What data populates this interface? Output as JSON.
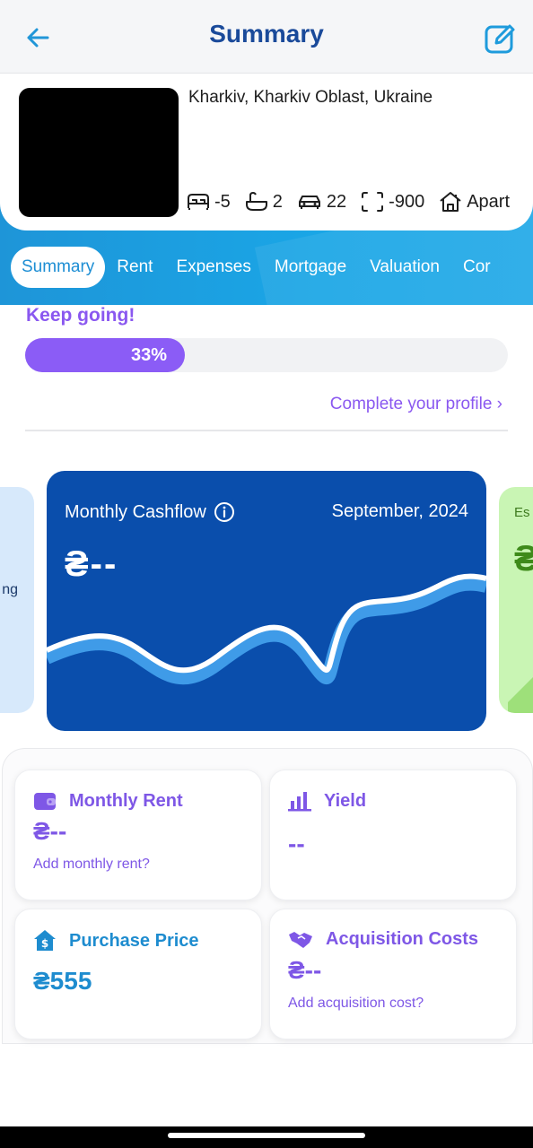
{
  "header": {
    "title": "Summary",
    "back_icon": "arrow-left-icon",
    "edit_icon": "edit-square-icon"
  },
  "property": {
    "location": "Kharkiv, Kharkiv Oblast, Ukraine",
    "attributes": [
      {
        "icon": "bed-icon",
        "value": "-5"
      },
      {
        "icon": "bathtub-icon",
        "value": "2"
      },
      {
        "icon": "car-icon",
        "value": "22"
      },
      {
        "icon": "area-icon",
        "value": "-900"
      },
      {
        "icon": "home-icon",
        "value": "Apart"
      }
    ]
  },
  "tabs": [
    "Summary",
    "Rent",
    "Expenses",
    "Mortgage",
    "Valuation",
    "Cor"
  ],
  "progress": {
    "label": "Keep going!",
    "percent_text": "33%",
    "percent": 33,
    "link": "Complete your profile ›"
  },
  "cards": {
    "left_partial_text": "ng",
    "cashflow": {
      "title": "Monthly Cashflow",
      "date": "September, 2024",
      "value": "₴--"
    },
    "right_partial_label": "Es",
    "right_partial_value": "₴"
  },
  "stats": {
    "monthly_rent": {
      "title": "Monthly Rent",
      "value": "₴--",
      "link": "Add monthly rent?"
    },
    "yield": {
      "title": "Yield",
      "value": "--"
    },
    "purchase_price": {
      "title": "Purchase Price",
      "value": "₴555"
    },
    "acquisition_costs": {
      "title": "Acquisition Costs",
      "value": "₴--",
      "link": "Add acquisition cost?"
    }
  },
  "colors": {
    "brand_blue": "#1a4a9a",
    "accent_purple": "#8b5cf6",
    "card_blue": "#0a4eac",
    "teal": "#1e8ccf"
  }
}
